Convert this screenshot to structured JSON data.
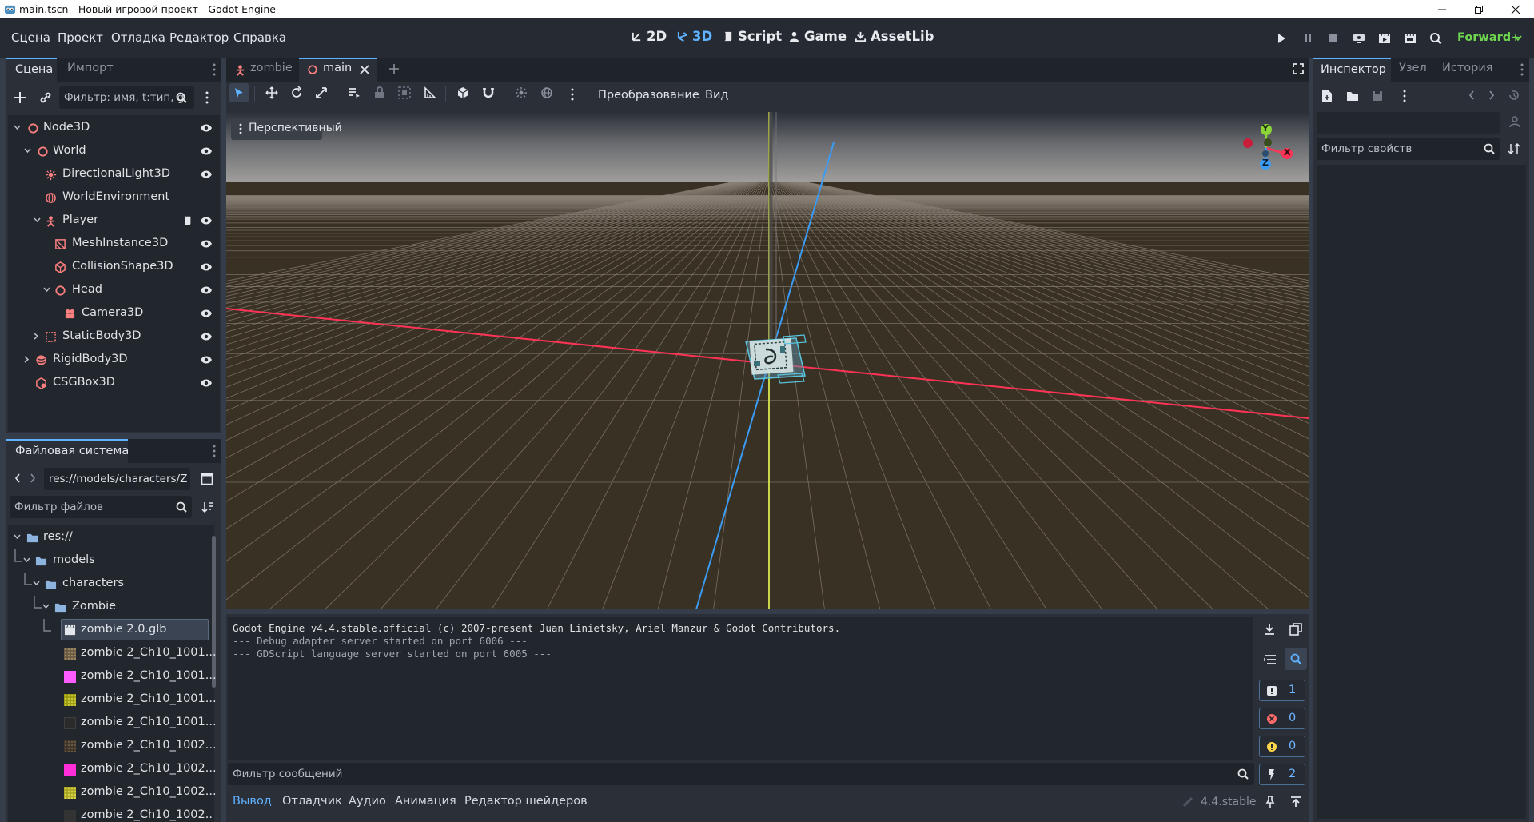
{
  "window": {
    "title": "main.tscn - Новый игровой проект - Godot Engine"
  },
  "menubar": {
    "items": [
      "Сцена",
      "Проект",
      "Отладка",
      "Редактор",
      "Справка"
    ],
    "workspaces": [
      {
        "label": "2D",
        "icon": "2d-icon"
      },
      {
        "label": "3D",
        "icon": "3d-icon",
        "active": true
      },
      {
        "label": "Script",
        "icon": "script-icon"
      },
      {
        "label": "Game",
        "icon": "game-icon"
      },
      {
        "label": "AssetLib",
        "icon": "assetlib-icon"
      }
    ],
    "renderer": "Forward+"
  },
  "scene_dock": {
    "tabs": [
      "Сцена",
      "Импорт"
    ],
    "filter_placeholder": "Фильтр: имя, t:тип, g",
    "nodes": [
      {
        "name": "Node3D",
        "icon": "node3d-icon",
        "depth": 0,
        "expanded": true
      },
      {
        "name": "World",
        "icon": "node3d-icon",
        "depth": 1,
        "expanded": true
      },
      {
        "name": "DirectionalLight3D",
        "icon": "light-icon",
        "depth": 2
      },
      {
        "name": "WorldEnvironment",
        "icon": "globe-icon",
        "depth": 2
      },
      {
        "name": "Player",
        "icon": "character-body-icon",
        "depth": 2,
        "expanded": true,
        "script": true
      },
      {
        "name": "MeshInstance3D",
        "icon": "mesh-icon",
        "depth": 3
      },
      {
        "name": "CollisionShape3D",
        "icon": "collision-shape-icon",
        "depth": 3
      },
      {
        "name": "Head",
        "icon": "node3d-icon",
        "depth": 3,
        "expanded": true
      },
      {
        "name": "Camera3D",
        "icon": "camera-icon",
        "depth": 4
      },
      {
        "name": "StaticBody3D",
        "icon": "static-body-icon",
        "depth": 2,
        "collapsed": true
      },
      {
        "name": "RigidBody3D",
        "icon": "rigid-body-icon",
        "depth": 1,
        "collapsed": true
      },
      {
        "name": "CSGBox3D",
        "icon": "csg-box-icon",
        "depth": 1
      }
    ]
  },
  "filesystem_dock": {
    "title": "Файловая система",
    "path": "res://models/characters/Z",
    "filter_placeholder": "Фильтр файлов",
    "items": [
      {
        "name": "res://",
        "type": "folder",
        "depth": 0
      },
      {
        "name": "models",
        "type": "folder",
        "depth": 1
      },
      {
        "name": "characters",
        "type": "folder",
        "depth": 2
      },
      {
        "name": "Zombie",
        "type": "folder",
        "depth": 3
      },
      {
        "name": "zombie 2.0.glb",
        "type": "scene",
        "depth": 4,
        "selected": true
      },
      {
        "name": "zombie 2_Ch10_1001...",
        "type": "texture",
        "depth": 4,
        "color": "#6b5a46"
      },
      {
        "name": "zombie 2_Ch10_1001...",
        "type": "texture",
        "depth": 4,
        "color": "#ff5cff"
      },
      {
        "name": "zombie 2_Ch10_1001...",
        "type": "texture",
        "depth": 4,
        "color": "#9a9a12"
      },
      {
        "name": "zombie 2_Ch10_1001...",
        "type": "texture",
        "depth": 4,
        "color": "#2b2b2b"
      },
      {
        "name": "zombie 2_Ch10_1002...",
        "type": "texture",
        "depth": 4,
        "color": "#3d332a"
      },
      {
        "name": "zombie 2_Ch10_1002...",
        "type": "texture",
        "depth": 4,
        "color": "#ff2ed6"
      },
      {
        "name": "zombie 2_Ch10_1002...",
        "type": "texture",
        "depth": 4,
        "color": "#a8a624"
      },
      {
        "name": "zombie 2_Ch10_1002...",
        "type": "texture",
        "depth": 4,
        "color": "#333333"
      }
    ]
  },
  "editor_tabs": {
    "tabs": [
      {
        "label": "zombie",
        "icon": "character-body-icon"
      },
      {
        "label": "main",
        "icon": "node3d-icon",
        "active": true
      }
    ]
  },
  "viewport_toolbar": {
    "transform_label": "Преобразование",
    "view_label": "Вид",
    "perspective_label": "Перспективный"
  },
  "gizmo": {
    "y_label": "Y",
    "x_label": "X",
    "z_label": "Z"
  },
  "output": {
    "lines": [
      "Godot Engine v4.4.stable.official (c) 2007-present Juan Linietsky, Ariel Manzur & Godot Contributors.",
      "--- Debug adapter server started on port 6006 ---",
      "--- GDScript language server started on port 6005 ---"
    ],
    "filter_placeholder": "Фильтр сообщений",
    "counters": {
      "messages": "1",
      "errors": "0",
      "warnings": "0",
      "editor": "2"
    }
  },
  "bottom_tabs": [
    "Вывод",
    "Отладчик",
    "Аудио",
    "Анимация",
    "Редактор шейдеров"
  ],
  "version": "4.4.stable",
  "inspector": {
    "tabs": [
      "Инспектор",
      "Узел",
      "История"
    ],
    "filter_placeholder": "Фильтр свойств"
  },
  "colors": {
    "accent": "#5fb2ff",
    "node3d": "#fc7f7f",
    "axis_x": "#ff3355",
    "axis_y": "#8bd43a",
    "axis_z": "#3a9cf5"
  }
}
